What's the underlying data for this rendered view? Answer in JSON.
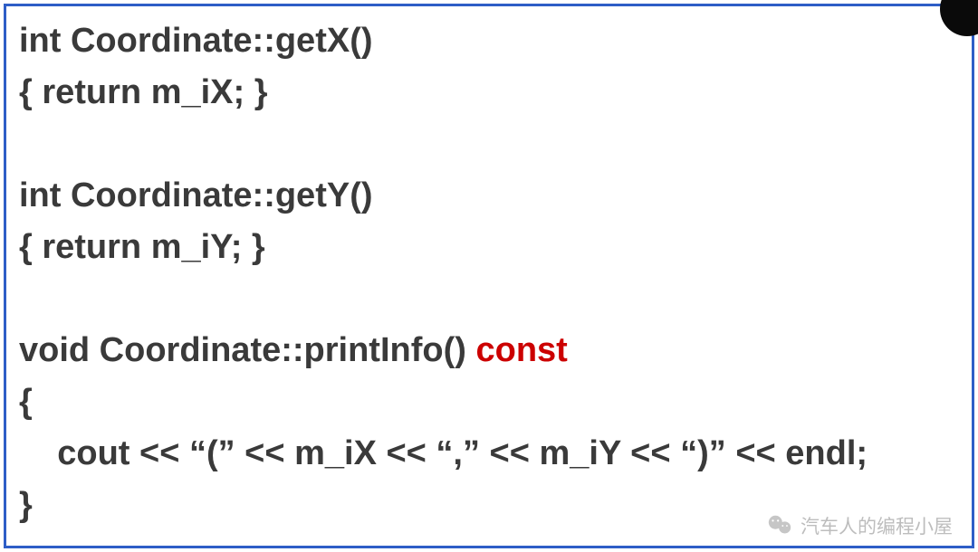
{
  "code": {
    "line1": "int Coordinate::getX()",
    "line2": "{ return m_iX; }",
    "line3": "int Coordinate::getY()",
    "line4": "{ return m_iY; }",
    "line5_prefix": "void Coordinate::printInfo() ",
    "line5_keyword": "const",
    "line6": "{",
    "line7": "    cout << “(” << m_iX << “,” << m_iY << “)” << endl;",
    "line8": "}"
  },
  "watermark": {
    "text": "汽车人的编程小屋"
  }
}
